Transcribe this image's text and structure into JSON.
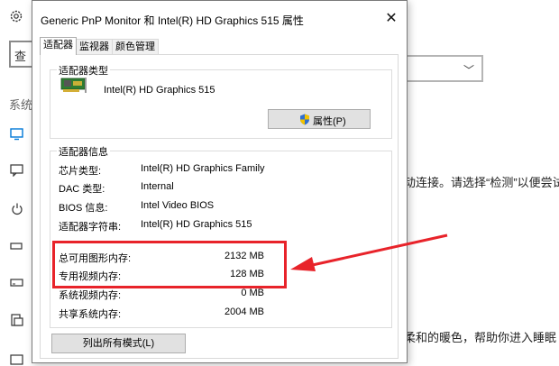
{
  "background": {
    "search_hint": "查",
    "system_label": "系统",
    "text_line1": "动连接。请选择“检测”以便尝试",
    "text_line2": "柔和的暖色，帮助你进入睡眠"
  },
  "dialog": {
    "title": "Generic PnP Monitor 和 Intel(R) HD Graphics 515 属性",
    "close_glyph": "✕",
    "tabs": [
      "适配器",
      "监视器",
      "颜色管理"
    ],
    "adapter_type": {
      "group_title": "适配器类型",
      "name": "Intel(R) HD Graphics 515",
      "properties_button": "属性(P)"
    },
    "adapter_info": {
      "group_title": "适配器信息",
      "rows": [
        {
          "label": "芯片类型:",
          "value": "Intel(R) HD Graphics Family"
        },
        {
          "label": "DAC 类型:",
          "value": "Internal"
        },
        {
          "label": "BIOS 信息:",
          "value": "Intel Video BIOS"
        },
        {
          "label": "适配器字符串:",
          "value": "Intel(R) HD Graphics 515"
        }
      ],
      "memory": [
        {
          "label": "总可用图形内存:",
          "value": "2132 MB"
        },
        {
          "label": "专用视频内存:",
          "value": "128 MB"
        },
        {
          "label": "系统视频内存:",
          "value": "0 MB"
        },
        {
          "label": "共享系统内存:",
          "value": "2004 MB"
        }
      ]
    },
    "list_modes_button": "列出所有模式(L)"
  },
  "annotation": {
    "color": "#e8232a"
  }
}
